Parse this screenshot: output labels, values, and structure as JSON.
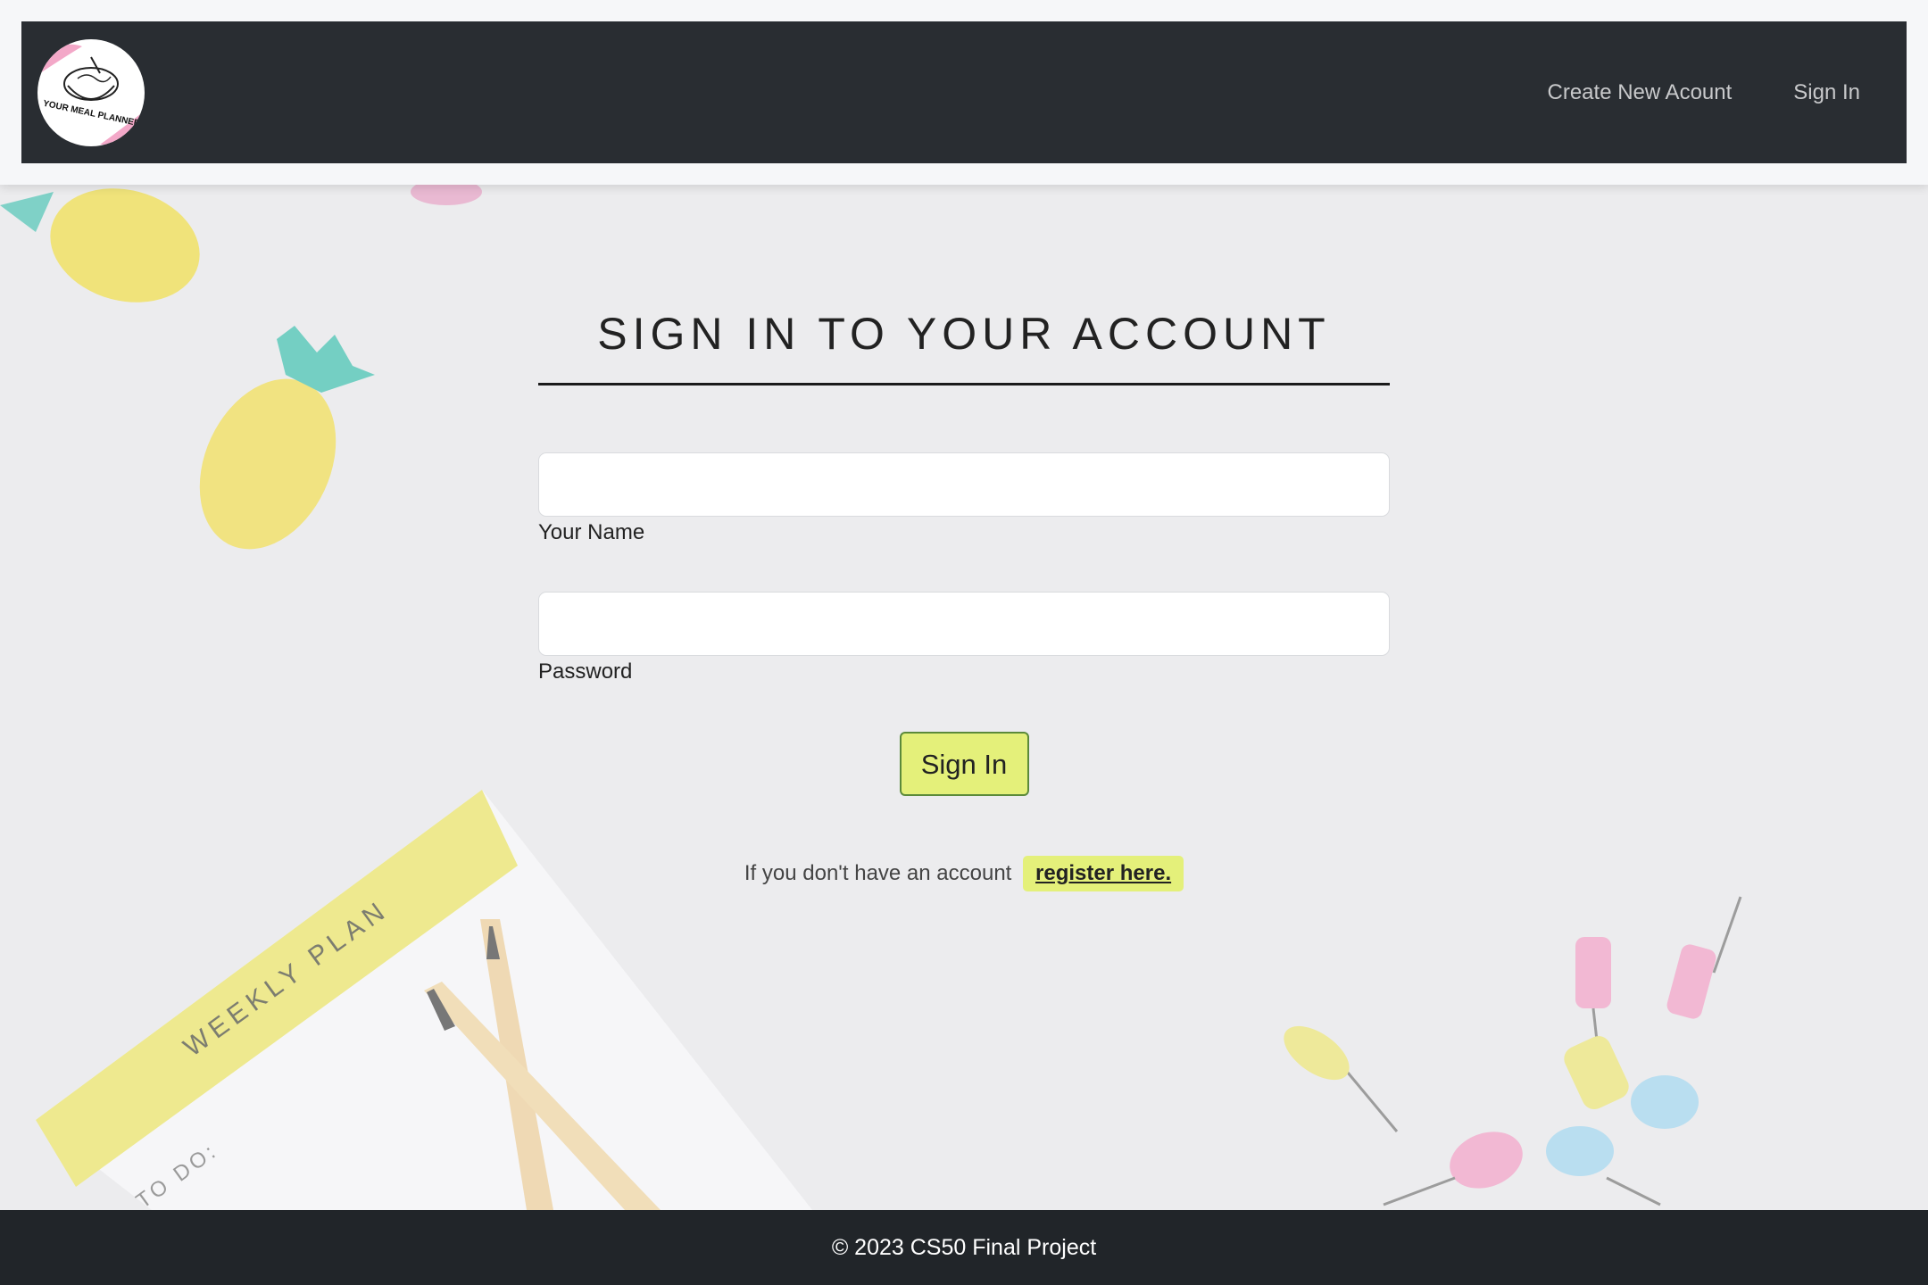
{
  "app": {
    "logo_text": "YOUR MEAL PLANNER"
  },
  "nav": {
    "create_account": "Create New Acount",
    "sign_in": "Sign In"
  },
  "form": {
    "title": "SIGN IN TO YOUR ACCOUNT",
    "name_label": "Your Name",
    "name_value": "",
    "password_label": "Password",
    "password_value": "",
    "submit_label": "Sign In",
    "register_prompt": "If you don't have an account",
    "register_link": "register here."
  },
  "background": {
    "notepad_title": "WEEKLY PLAN",
    "notepad_todo": "TO DO:"
  },
  "footer": {
    "text": "© 2023 CS50 Final Project"
  },
  "colors": {
    "navbar": "#292d32",
    "accent": "#e4f07a",
    "footer": "#212529"
  }
}
